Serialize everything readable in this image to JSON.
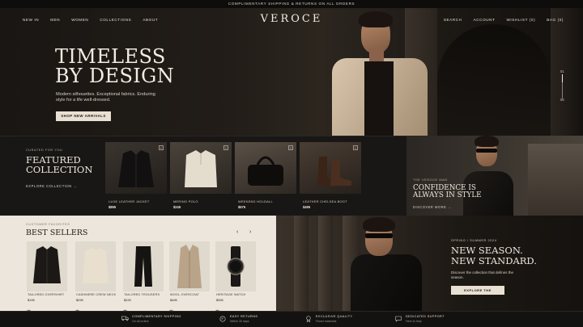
{
  "announcement": "COMPLIMENTARY SHIPPING & RETURNS ON ALL ORDERS",
  "brand": "VEROCE",
  "nav_left": [
    "NEW IN",
    "MEN",
    "WOMEN",
    "COLLECTIONS",
    "ABOUT"
  ],
  "nav_right": [
    "SEARCH",
    "ACCOUNT",
    "WISHLIST (0)",
    "BAG (0)"
  ],
  "hero": {
    "title_line1": "TIMELESS",
    "title_line2": "BY DESIGN",
    "subtitle": "Modern silhouettes. Exceptional fabrics. Enduring style for a life well-dressed.",
    "cta": "SHOP NEW ARRIVALS",
    "slide_current": "01",
    "slide_total": "06"
  },
  "featured": {
    "eyebrow": "CURATED FOR YOU",
    "title_line1": "FEATURED",
    "title_line2": "COLLECTION",
    "link": "EXPLORE COLLECTION",
    "products": [
      {
        "name": "LUXE LEATHER JACKET",
        "price": "$895",
        "icon": "leather-jacket"
      },
      {
        "name": "MERINO POLO",
        "price": "$245",
        "icon": "polo-shirt"
      },
      {
        "name": "WEEKEND HOLDALL",
        "price": "$575",
        "icon": "holdall-bag"
      },
      {
        "name": "LEATHER CHELSEA BOOT",
        "price": "$495",
        "icon": "chelsea-boot"
      }
    ]
  },
  "confidence": {
    "eyebrow": "THE VEROCE MAN",
    "title_line1": "CONFIDENCE IS",
    "title_line2": "ALWAYS IN STYLE",
    "link": "DISCOVER MORE"
  },
  "best_sellers": {
    "eyebrow": "CUSTOMER FAVORITES",
    "title": "BEST SELLERS",
    "products": [
      {
        "name": "TAILORED OVERSHIRT",
        "price": "$195",
        "swatches": [
          "#1d1a16",
          "#3a3530"
        ]
      },
      {
        "name": "CASHMERE CREW NECK",
        "price": "$295",
        "swatches": [
          "#1d1a16",
          "#d8ccb8"
        ]
      },
      {
        "name": "TAILORED TROUSERS",
        "price": "$225",
        "swatches": [
          "#1d1a16",
          "#3a3530"
        ]
      },
      {
        "name": "WOOL OVERCOAT",
        "price": "$495",
        "swatches": [
          "#b9a489",
          "#1d1a16"
        ]
      },
      {
        "name": "HERITAGE WATCH",
        "price": "$395",
        "swatches": [
          "#1d1a16",
          "#8a7f71"
        ]
      }
    ]
  },
  "season": {
    "eyebrow": "SPRING / SUMMER 2024",
    "title_line1": "NEW SEASON.",
    "title_line2": "NEW STANDARD.",
    "subtitle": "Discover the collection that defines the season.",
    "cta": "EXPLORE THE COLLECTION"
  },
  "features": [
    {
      "title": "COMPLIMENTARY SHIPPING",
      "sub": "On all orders",
      "icon": "truck-icon"
    },
    {
      "title": "EASY RETURNS",
      "sub": "Within 30 days",
      "icon": "return-icon"
    },
    {
      "title": "EXCLUSIVE QUALITY",
      "sub": "Finest materials",
      "icon": "award-icon"
    },
    {
      "title": "DEDICATED SUPPORT",
      "sub": "Here to help",
      "icon": "chat-icon"
    }
  ],
  "colors": {
    "dark": "#141210",
    "cream": "#ece6dc",
    "button": "#e8e0d2"
  }
}
